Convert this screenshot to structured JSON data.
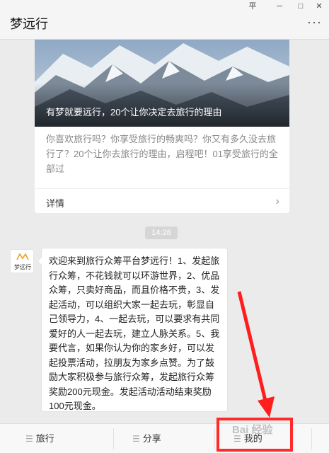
{
  "window": {
    "title": "梦远行",
    "controls": {
      "pin": "平",
      "minimize": "─",
      "maximize": "□",
      "close": "✕"
    },
    "more": "···"
  },
  "article_card": {
    "image_title": "有梦就要远行，20个让你决定去旅行的理由",
    "description": "你喜欢旅行吗？你享受旅行的畅爽吗？你又有多久没去旅行了？20个让你去旅行的理由，启程吧！01享受旅行的全部过",
    "more_label": "详情",
    "arrow": "›"
  },
  "timestamp": "14:28",
  "message": {
    "avatar_label": "梦远行",
    "text": "欢迎来到旅行众筹平台梦远行！1、发起旅行众筹，不花钱就可以环游世界，2、优品众筹，只卖好商品，而且价格不贵，3、发起活动，可以组织大家一起去玩，彰显自己领导力，4、一起去玩，可以要求有共同爱好的人一起去玩，建立人脉关系。5、我要代言，如果你认为你的家乡好，可以发起投票活动，拉朋友为家乡点赞。为了鼓励大家积极参与旅行众筹，发起旅行众筹奖励200元现金。发起活动活动结束奖励100元现金。"
  },
  "bottom_menu": {
    "tabs": [
      {
        "label": "旅行",
        "icon": "menu-icon"
      },
      {
        "label": "分享",
        "icon": "menu-icon"
      },
      {
        "label": "我的",
        "icon": "menu-icon"
      }
    ]
  },
  "watermark": "Bai 经验",
  "colors": {
    "highlight": "#ff2a2a",
    "arrow": "#ff1e1e"
  }
}
